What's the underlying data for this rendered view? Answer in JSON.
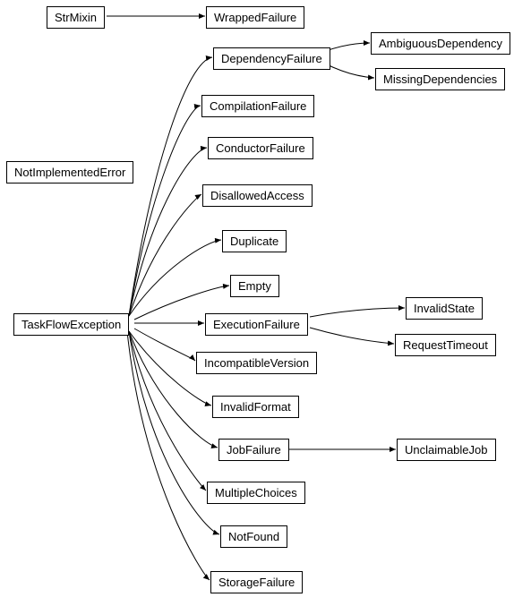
{
  "nodes": {
    "strMixin": "StrMixin",
    "wrappedFailure": "WrappedFailure",
    "dependencyFailure": "DependencyFailure",
    "ambiguousDependency": "AmbiguousDependency",
    "missingDependencies": "MissingDependencies",
    "compilationFailure": "CompilationFailure",
    "conductorFailure": "ConductorFailure",
    "notImplementedError": "NotImplementedError",
    "disallowedAccess": "DisallowedAccess",
    "duplicate": "Duplicate",
    "empty": "Empty",
    "taskFlowException": "TaskFlowException",
    "executionFailure": "ExecutionFailure",
    "invalidState": "InvalidState",
    "requestTimeout": "RequestTimeout",
    "incompatibleVersion": "IncompatibleVersion",
    "invalidFormat": "InvalidFormat",
    "jobFailure": "JobFailure",
    "unclaimableJob": "UnclaimableJob",
    "multipleChoices": "MultipleChoices",
    "notFound": "NotFound",
    "storageFailure": "StorageFailure"
  },
  "diagram": {
    "edges": [
      [
        "StrMixin",
        "WrappedFailure"
      ],
      [
        "DependencyFailure",
        "AmbiguousDependency"
      ],
      [
        "DependencyFailure",
        "MissingDependencies"
      ],
      [
        "TaskFlowException",
        "DependencyFailure"
      ],
      [
        "TaskFlowException",
        "CompilationFailure"
      ],
      [
        "TaskFlowException",
        "ConductorFailure"
      ],
      [
        "TaskFlowException",
        "DisallowedAccess"
      ],
      [
        "TaskFlowException",
        "Duplicate"
      ],
      [
        "TaskFlowException",
        "Empty"
      ],
      [
        "TaskFlowException",
        "ExecutionFailure"
      ],
      [
        "TaskFlowException",
        "IncompatibleVersion"
      ],
      [
        "TaskFlowException",
        "InvalidFormat"
      ],
      [
        "TaskFlowException",
        "JobFailure"
      ],
      [
        "TaskFlowException",
        "MultipleChoices"
      ],
      [
        "TaskFlowException",
        "NotFound"
      ],
      [
        "TaskFlowException",
        "StorageFailure"
      ],
      [
        "ExecutionFailure",
        "InvalidState"
      ],
      [
        "ExecutionFailure",
        "RequestTimeout"
      ],
      [
        "JobFailure",
        "UnclaimableJob"
      ]
    ]
  }
}
